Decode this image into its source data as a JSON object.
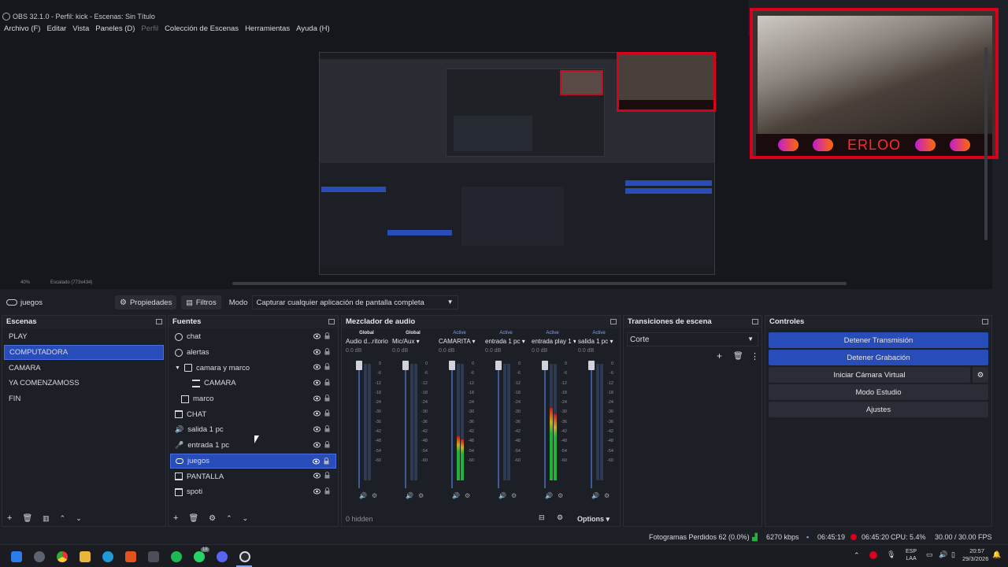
{
  "window": {
    "title": "OBS 32.1.0 - Perfil: kick - Escenas: Sin Título"
  },
  "menu": [
    "Archivo (F)",
    "Editar",
    "Vista",
    "Paneles (D)",
    "Perfil",
    "Colección de Escenas",
    "Herramientas",
    "Ayuda (H)"
  ],
  "camera_overlay": {
    "name": "ERLOO"
  },
  "zoom": {
    "percent": "40%",
    "scaling": "Escalado (773x434)"
  },
  "toolbar": {
    "source": "juegos",
    "properties": "Propiedades",
    "filters": "Filtros",
    "mode_label": "Modo",
    "mode_value": "Capturar cualquier aplicación de pantalla completa"
  },
  "scenes": {
    "title": "Escenas",
    "items": [
      "PLAY",
      "COMPUTADORA",
      "CAMARA",
      "YA COMENZAMOSS",
      "FIN"
    ],
    "selected": "COMPUTADORA"
  },
  "sources": {
    "title": "Fuentes",
    "items": [
      {
        "label": "chat",
        "icon": "browser-icon"
      },
      {
        "label": "alertas",
        "icon": "browser-icon"
      },
      {
        "label": "camara y marco",
        "icon": "folder-icon"
      },
      {
        "label": "CAMARA",
        "icon": "camera-icon"
      },
      {
        "label": "marco",
        "icon": "image-icon"
      },
      {
        "label": "CHAT",
        "icon": "window-icon"
      },
      {
        "label": "salida 1 pc",
        "icon": "speaker-icon"
      },
      {
        "label": "entrada 1 pc",
        "icon": "mic-icon"
      },
      {
        "label": "juegos",
        "icon": "gamepad-icon"
      },
      {
        "label": "PANTALLA",
        "icon": "monitor-icon"
      },
      {
        "label": "spoti",
        "icon": "window-icon"
      }
    ],
    "selected": "juegos"
  },
  "mixer": {
    "title": "Mezclador de audio",
    "channels": [
      {
        "scope": "Global",
        "name": "Audio d...ritorio",
        "db": "0.0 dB",
        "level": 0.0
      },
      {
        "scope": "Global",
        "name": "Mic/Aux",
        "db": "0.0 dB",
        "level": 0.0
      },
      {
        "scope": "Active",
        "name": "CAMARITA",
        "db": "0.0 dB",
        "level": 0.38
      },
      {
        "scope": "Active",
        "name": "entrada 1 pc",
        "db": "0.0 dB",
        "level": 0.0
      },
      {
        "scope": "Active",
        "name": "entrada play 1",
        "db": "0.0 dB",
        "level": 0.62
      },
      {
        "scope": "Active",
        "name": "salida 1 pc",
        "db": "0.0 dB",
        "level": 0.0
      }
    ],
    "scale": [
      "0",
      "-6",
      "-12",
      "-18",
      "-24",
      "-30",
      "-36",
      "-42",
      "-48",
      "-54",
      "-60"
    ],
    "hidden": "0 hidden",
    "options": "Options"
  },
  "transitions": {
    "title": "Transiciones de escena",
    "value": "Corte"
  },
  "controls": {
    "title": "Controles",
    "stop_stream": "Detener Transmisión",
    "stop_recording": "Detener Grabación",
    "virtual_cam": "Iniciar Cámara Virtual",
    "studio_mode": "Modo Estudio",
    "settings": "Ajustes"
  },
  "status": {
    "dropped": "Fotogramas Perdidos 62 (0.0%)",
    "bitrate": "6270 kbps",
    "stream_time": "06:45:19",
    "rec_time": "06:45:20",
    "cpu": "CPU: 5.4%",
    "fps": "30.00 / 30.00 FPS"
  },
  "taskbar": {
    "lang": "ESP",
    "lang2": "LAA",
    "time": "20:57",
    "date": "29/3/2026",
    "badge": "18"
  },
  "colors": {
    "accent": "#284cb8",
    "record": "#d8001a",
    "meter_green": "#1fb33a"
  }
}
